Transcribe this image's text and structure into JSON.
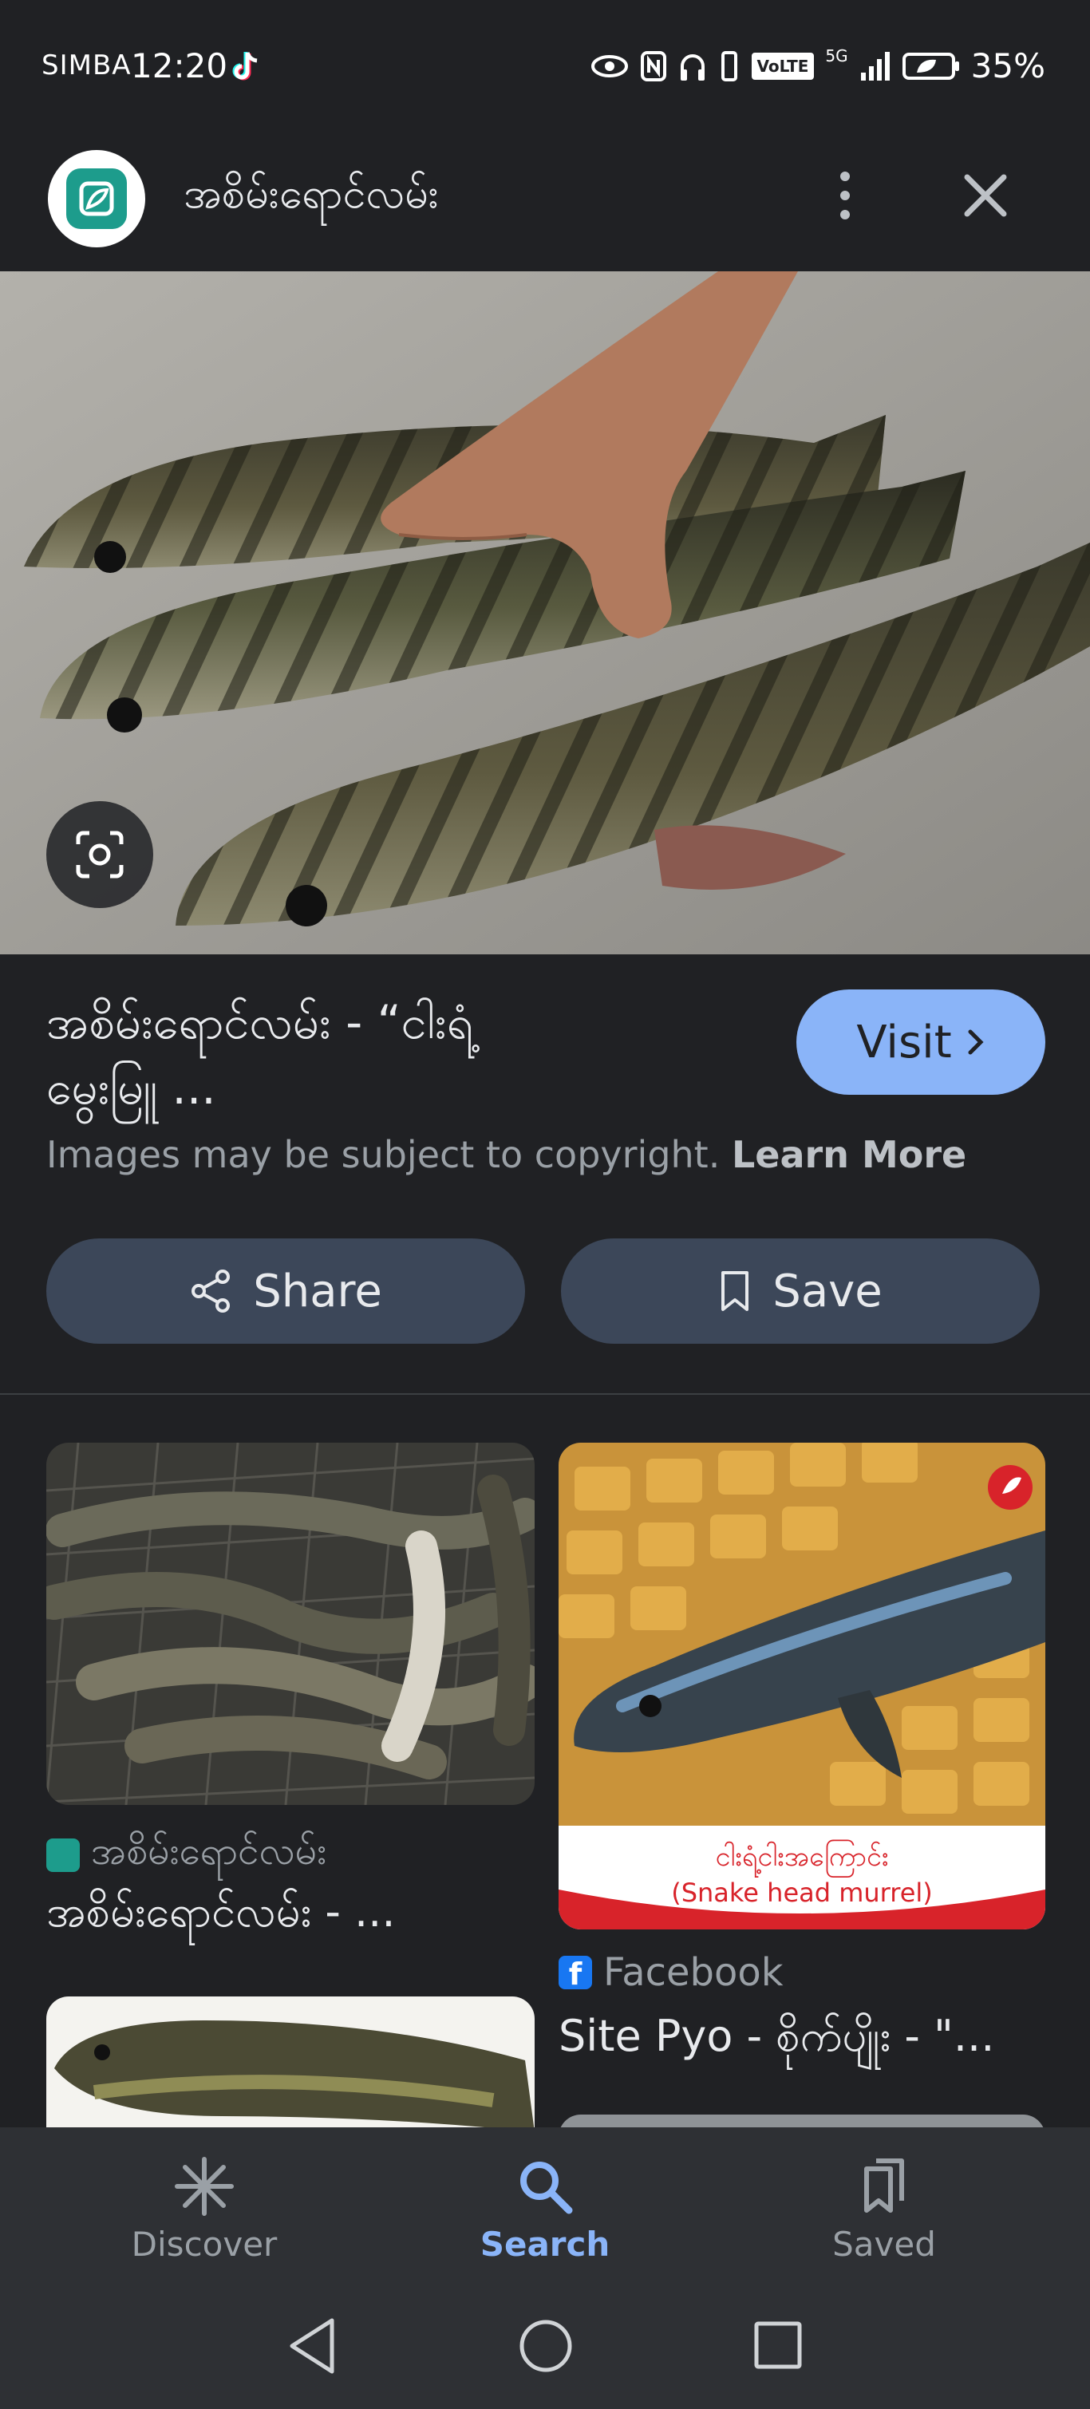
{
  "status": {
    "carrier": "SIMBA",
    "time": "12:20",
    "network": "VoLTE",
    "signal": "5G",
    "battery": "35%"
  },
  "header": {
    "title": "အစိမ်းရောင်လမ်း"
  },
  "result": {
    "title_line1": "အစိမ်းရောင်လမ်း - “ငါးရံ့",
    "title_line2": "မွေးမြူ ...",
    "visit_label": "Visit",
    "copyright_text": "Images may be subject to copyright.",
    "learn_more": "Learn More",
    "share_label": "Share",
    "save_label": "Save"
  },
  "related": [
    {
      "source": "အစိမ်းရောင်လမ်း",
      "snippet": "အစိမ်းရောင်လမ်း - ..."
    },
    {
      "source": "Facebook",
      "snippet": "Site Pyo - စိုက်ပျိုး - \"...",
      "caption_line1": "ငါးရံ့ငါးအကြောင်း",
      "caption_line2": "(Snake head murrel)"
    }
  ],
  "nav": {
    "discover": "Discover",
    "search": "Search",
    "saved": "Saved"
  },
  "colors": {
    "background": "#202124",
    "accent": "#8ab4f8",
    "button_bg": "#3c4759",
    "site_logo": "#1d9c8c"
  }
}
